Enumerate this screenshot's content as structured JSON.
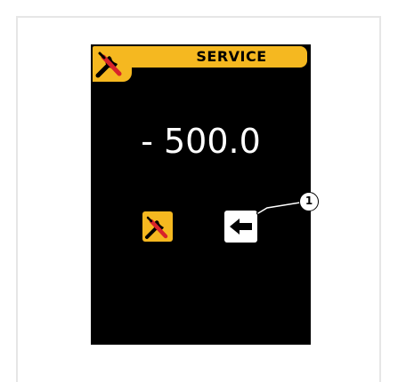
{
  "screen": {
    "header": {
      "title": "SERVICE",
      "icon": "wrench-screwdriver-icon"
    },
    "value": "- 500.0",
    "buttons": [
      {
        "name": "service-tool-button",
        "icon": "wrench-screwdriver-icon"
      },
      {
        "name": "back-button",
        "icon": "arrow-left-icon"
      }
    ]
  },
  "callout": {
    "label": "1"
  },
  "colors": {
    "accent": "#f5b820",
    "screen_bg": "#000000",
    "text": "#ffffff",
    "tool_red": "#d8232a"
  }
}
